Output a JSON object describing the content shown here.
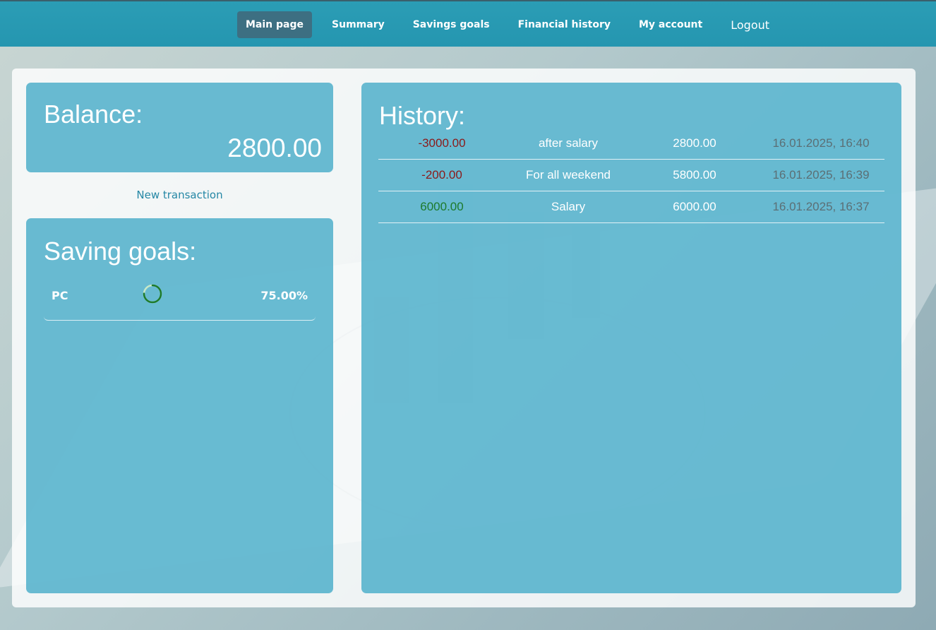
{
  "nav": {
    "items": [
      {
        "label": "Main page",
        "active": true
      },
      {
        "label": "Summary",
        "active": false
      },
      {
        "label": "Savings goals",
        "active": false
      },
      {
        "label": "Financial history",
        "active": false
      },
      {
        "label": "My account",
        "active": false
      }
    ],
    "logout_label": "Logout"
  },
  "balance": {
    "title": "Balance:",
    "value": "2800.00"
  },
  "new_transaction_label": "New transaction",
  "goals": {
    "title": "Saving goals:",
    "items": [
      {
        "name": "PC",
        "progress_percent": 75,
        "progress_label": "75.00%"
      }
    ]
  },
  "history": {
    "title": "History:",
    "rows": [
      {
        "amount": "-3000.00",
        "kind": "negative",
        "description": "after salary",
        "balance": "2800.00",
        "date": "16.01.2025, 16:40"
      },
      {
        "amount": "-200.00",
        "kind": "negative",
        "description": "For all weekend",
        "balance": "5800.00",
        "date": "16.01.2025, 16:39"
      },
      {
        "amount": "6000.00",
        "kind": "positive",
        "description": "Salary",
        "balance": "6000.00",
        "date": "16.01.2025, 16:37"
      }
    ]
  },
  "colors": {
    "nav_bg": "#2596b0",
    "nav_active": "#3d6f82",
    "panel_bg": "#54b2cc",
    "negative": "#8b1a1a",
    "positive": "#1d7a2c",
    "link": "#2587a5"
  }
}
